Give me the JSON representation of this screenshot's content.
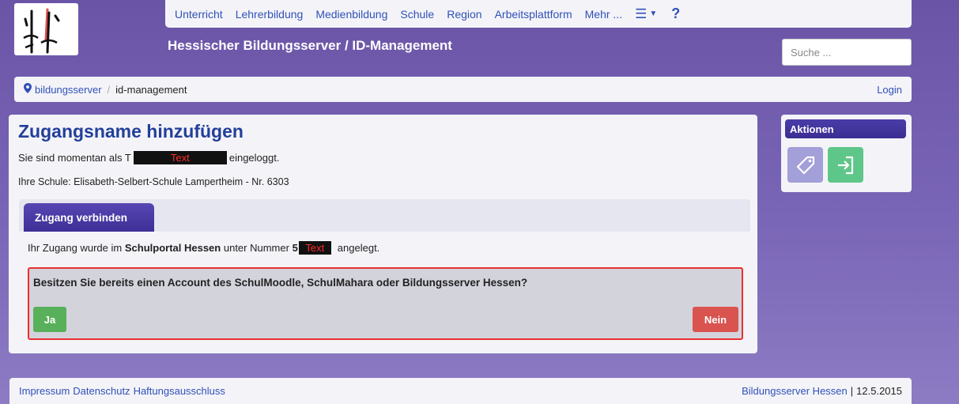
{
  "nav": {
    "items": [
      "Unterricht",
      "Lehrerbildung",
      "Medienbildung",
      "Schule",
      "Region",
      "Arbeitsplattform",
      "Mehr ..."
    ],
    "menu_icon": "hamburger-menu-icon",
    "help_label": "?"
  },
  "header": {
    "site_title": "Hessischer Bildungsserver / ID-Management",
    "search_placeholder": "Suche ..."
  },
  "breadcrumb": {
    "items": [
      "bildungsserver",
      "id-management"
    ],
    "login_label": "Login"
  },
  "main": {
    "title": "Zugangsname hinzufügen",
    "logged_in_prefix": "Sie sind momentan als T",
    "logged_in_redacted": "Text",
    "logged_in_suffix": "eingeloggt.",
    "school_line": "Ihre Schule: Elisabeth-Selbert-Schule Lampertheim - Nr. 6303",
    "tab_label": "Zugang verbinden",
    "info_prefix": "Ihr Zugang wurde im",
    "info_portal": "Schulportal Hessen",
    "info_middle": "unter Nummer",
    "info_number_start": "5",
    "info_redacted": "Text",
    "info_suffix": "angelegt.",
    "question": "Besitzen Sie bereits einen Account des SchulMoodle, SchulMahara oder Bildungsserver Hessen?",
    "yes_label": "Ja",
    "no_label": "Nein"
  },
  "actions": {
    "header": "Aktionen",
    "buttons": [
      {
        "icon": "tag-icon"
      },
      {
        "icon": "sign-in-icon"
      }
    ]
  },
  "footer": {
    "links": [
      "Impressum",
      "Datenschutz",
      "Haftungsausschluss"
    ],
    "right_link": "Bildungsserver Hessen",
    "date": "12.5.2015"
  },
  "colors": {
    "background": "#6a54a6",
    "link": "#3050b8",
    "title": "#233f9a",
    "yes": "#58b05a",
    "no": "#d9534f",
    "highlight_border": "#e83030"
  }
}
